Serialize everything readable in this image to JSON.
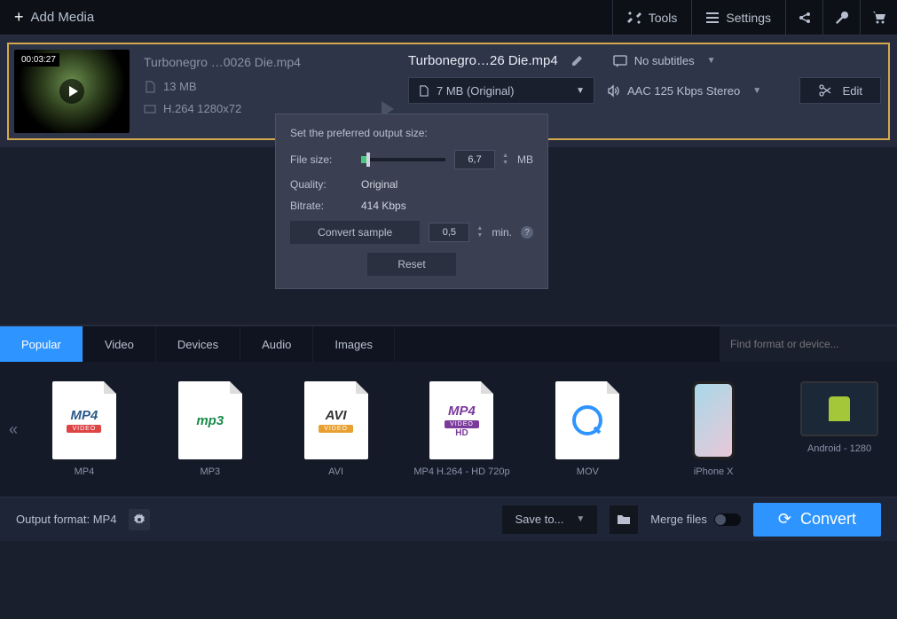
{
  "topbar": {
    "add_media": "Add Media",
    "tools": "Tools",
    "settings": "Settings"
  },
  "file": {
    "duration": "00:03:27",
    "input_name": "Turbonegro  …0026 Die.mp4",
    "input_size": "13 MB",
    "input_codec": "H.264 1280x72",
    "output_name": "Turbonegro…26 Die.mp4",
    "subtitles": "No subtitles",
    "size_preset": "7 MB (Original)",
    "audio": "AAC 125 Kbps Stereo",
    "edit": "Edit"
  },
  "popup": {
    "title": "Set the preferred output size:",
    "filesize_label": "File size:",
    "filesize_value": "6,7",
    "filesize_unit": "MB",
    "quality_label": "Quality:",
    "quality_value": "Original",
    "bitrate_label": "Bitrate:",
    "bitrate_value": "414 Kbps",
    "convert_sample": "Convert sample",
    "sample_value": "0,5",
    "sample_unit": "min.",
    "reset": "Reset"
  },
  "tabs": {
    "popular": "Popular",
    "video": "Video",
    "devices": "Devices",
    "audio": "Audio",
    "images": "Images",
    "search_placeholder": "Find format or device..."
  },
  "formats": [
    {
      "label": "MP4"
    },
    {
      "label": "MP3"
    },
    {
      "label": "AVI"
    },
    {
      "label": "MP4 H.264 - HD 720p"
    },
    {
      "label": "MOV"
    },
    {
      "label": "iPhone X"
    },
    {
      "label": "Android - 1280"
    }
  ],
  "bottom": {
    "output_format": "Output format: MP4",
    "save_to": "Save to...",
    "merge": "Merge files",
    "convert": "Convert"
  }
}
